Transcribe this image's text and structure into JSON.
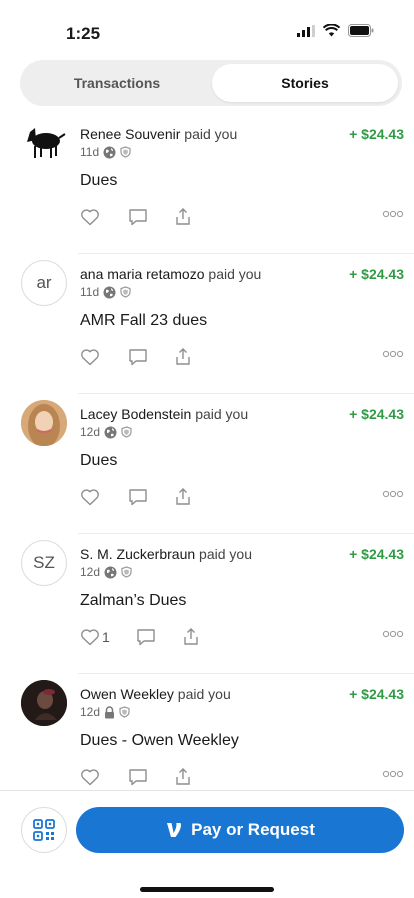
{
  "status": {
    "time": "1:25"
  },
  "tabs": [
    {
      "label": "Transactions",
      "selected": false
    },
    {
      "label": "Stories",
      "selected": true
    }
  ],
  "stories": [
    {
      "name": "Renee Souvenir",
      "verb": "paid you",
      "time": "11d",
      "privacy_icon": "globe-icon",
      "amount": "+ $24.43",
      "note": "Dues",
      "likes": ""
    },
    {
      "name": "ana maria retamozo",
      "verb": "paid you",
      "time": "11d",
      "privacy_icon": "globe-icon",
      "amount": "+ $24.43",
      "note": "AMR Fall 23 dues",
      "likes": "",
      "initials": "ar"
    },
    {
      "name": "Lacey Bodenstein",
      "verb": "paid you",
      "time": "12d",
      "privacy_icon": "globe-icon",
      "amount": "+ $24.43",
      "note": "Dues",
      "likes": ""
    },
    {
      "name": "S. M. Zuckerbraun",
      "verb": "paid you",
      "time": "12d",
      "privacy_icon": "globe-icon",
      "amount": "+ $24.43",
      "note": "Zalman’s Dues",
      "likes": "1",
      "initials": "SZ"
    },
    {
      "name": "Owen Weekley",
      "verb": "paid you",
      "time": "12d",
      "privacy_icon": "lock-icon",
      "amount": "+ $24.43",
      "note": "Dues - Owen Weekley",
      "likes": ""
    }
  ],
  "bottom": {
    "pay_label": "Pay or Request"
  },
  "colors": {
    "accent": "#1976d2",
    "positive": "#2e9c45"
  }
}
